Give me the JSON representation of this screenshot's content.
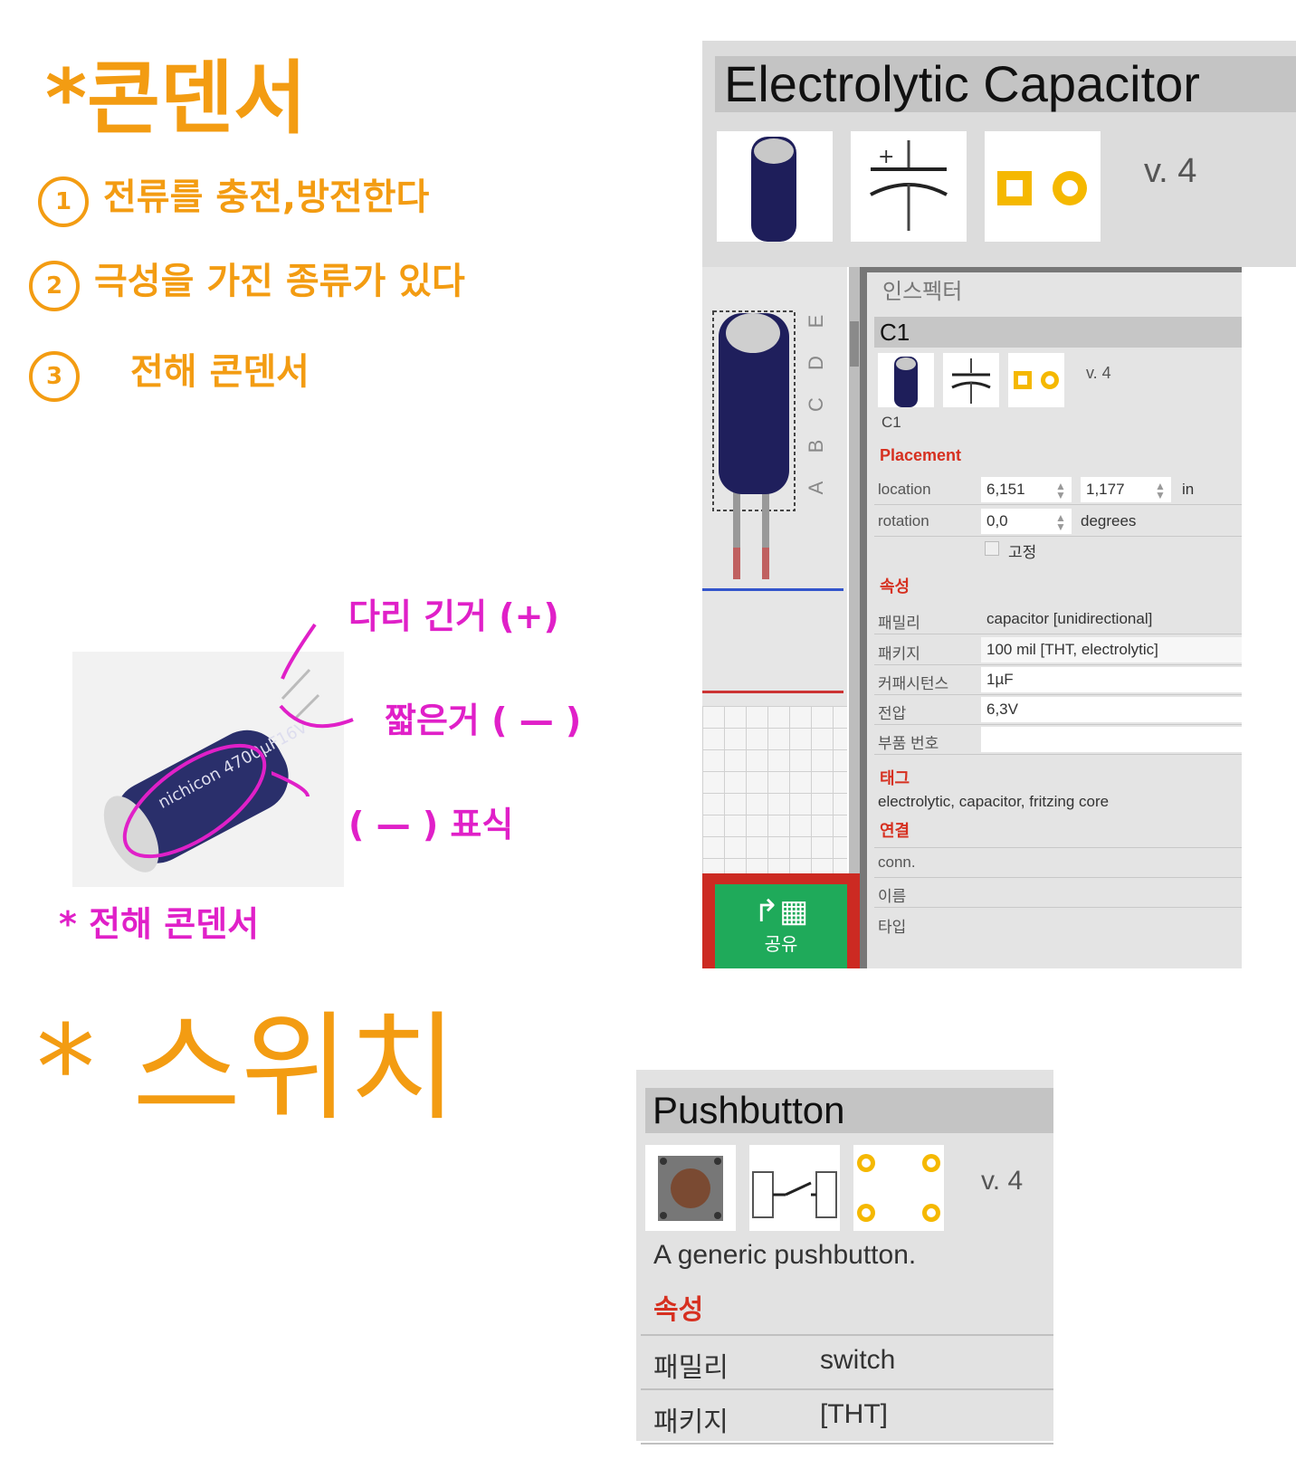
{
  "notes": {
    "title": "*콘덴서",
    "items": [
      {
        "num": "1",
        "text": "전류를 충전,방전한다"
      },
      {
        "num": "2",
        "text": "극성을 가진 종류가 있다"
      },
      {
        "num": "3",
        "text": "전해 콘덴서"
      }
    ],
    "annot_long_leg": "다리 긴거 (+)",
    "annot_short_leg": "짧은거 ( — )",
    "annot_minus_mark": "( — ) 표식",
    "annot_caption": "* 전해 콘덴서",
    "switch_title": "* 스위치"
  },
  "capacitor_card": {
    "title": "Electrolytic Capacitor",
    "version": "v. 4"
  },
  "breadboard": {
    "row_labels": [
      "E",
      "D",
      "C",
      "B",
      "A"
    ]
  },
  "inspector": {
    "title": "인스펙터",
    "part_title": "C1",
    "version": "v. 4",
    "part_label": "C1",
    "placement_heading": "Placement",
    "location_label": "location",
    "location_x": "6,151",
    "location_y": "1,177",
    "location_unit": "in",
    "rotation_label": "rotation",
    "rotation_value": "0,0",
    "rotation_unit": "degrees",
    "locked_label": "고정",
    "props_heading": "속성",
    "family_label": "패밀리",
    "family_value": "capacitor [unidirectional]",
    "package_label": "패키지",
    "package_value": "100 mil [THT, electrolytic]",
    "capacitance_label": "커패시턴스",
    "capacitance_value": "1µF",
    "voltage_label": "전압",
    "voltage_value": "6,3V",
    "partnum_label": "부품 번호",
    "partnum_value": "",
    "tags_heading": "태그",
    "tags_value": "electrolytic, capacitor, fritzing core",
    "conn_heading": "연결",
    "conn_label": "conn.",
    "name_label": "이름",
    "type_label": "타입"
  },
  "share_button": {
    "label": "공유"
  },
  "pushbutton": {
    "title": "Pushbutton",
    "version": "v. 4",
    "description": "A generic pushbutton.",
    "props_heading": "속성",
    "family_label": "패밀리",
    "family_value": "switch",
    "package_label": "패키지",
    "package_value": "[THT]"
  }
}
